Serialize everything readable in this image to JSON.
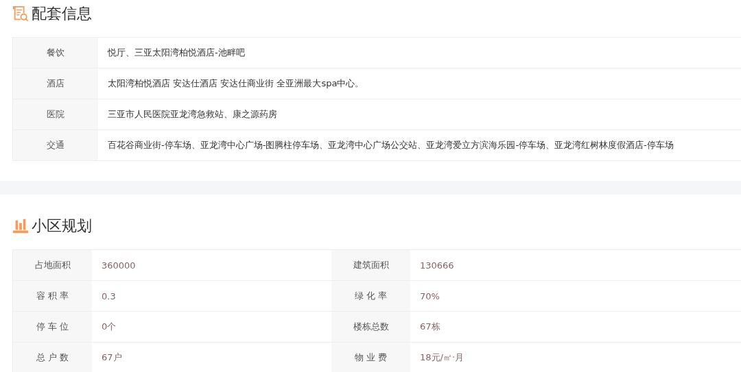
{
  "facilities": {
    "title": "配套信息",
    "rows": [
      {
        "label": "餐饮",
        "value": "悦厅、三亚太阳湾柏悦酒店-池畔吧"
      },
      {
        "label": "酒店",
        "value": "太阳湾柏悦酒店 安达仕酒店 安达仕商业街 全亚洲最大spa中心。"
      },
      {
        "label": "医院",
        "value": "三亚市人民医院亚龙湾急救站、康之源药房"
      },
      {
        "label": "交通",
        "value": "百花谷商业街-停车场、亚龙湾中心广场-图腾柱停车场、亚龙湾中心广场公交站、亚龙湾爱立方滨海乐园-停车场、亚龙湾红树林度假酒店-停车场"
      }
    ]
  },
  "planning": {
    "title": "小区规划",
    "rows": [
      [
        {
          "label": "占地面积",
          "value": "360000"
        },
        {
          "label": "建筑面积",
          "value": "130666"
        }
      ],
      [
        {
          "label": "容 积 率",
          "value": "0.3"
        },
        {
          "label": "绿 化 率",
          "value": "70%"
        }
      ],
      [
        {
          "label": "停 车 位",
          "value": "0个"
        },
        {
          "label": "楼栋总数",
          "value": "67栋"
        }
      ],
      [
        {
          "label": "总 户 数",
          "value": "67户"
        },
        {
          "label": "物 业 费",
          "value": "18元/㎡·月"
        }
      ]
    ]
  }
}
